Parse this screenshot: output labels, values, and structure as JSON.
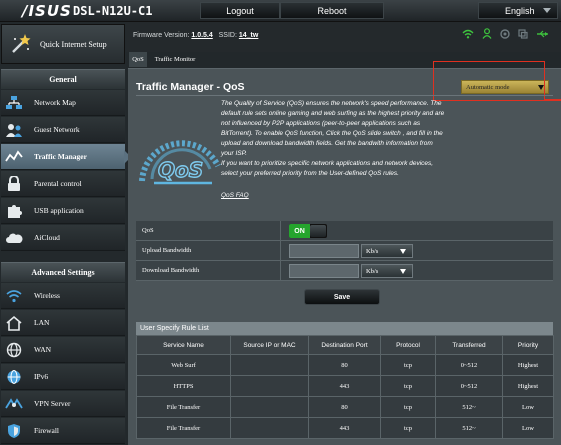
{
  "header": {
    "brand": "/ISUS",
    "model": "DSL-N12U-C1",
    "logout_label": "Logout",
    "reboot_label": "Reboot",
    "language": "English"
  },
  "infobar": {
    "firmware_label": "Firmware Version:",
    "firmware_version": "1.0.5.4",
    "ssid_label": "SSID:",
    "ssid_value": "14_tw"
  },
  "tabs": [
    {
      "label": "QoS"
    },
    {
      "label": "Traffic Monitor"
    }
  ],
  "sidebar": {
    "quick_setup": "Quick Internet Setup",
    "general_header": "General",
    "general_items": [
      {
        "label": "Network Map",
        "icon": "network-map-icon"
      },
      {
        "label": "Guest Network",
        "icon": "guest-network-icon"
      },
      {
        "label": "Traffic Manager",
        "icon": "traffic-manager-icon",
        "active": true
      },
      {
        "label": "Parental control",
        "icon": "lock-icon"
      },
      {
        "label": "USB application",
        "icon": "puzzle-icon"
      },
      {
        "label": "AiCloud",
        "icon": "cloud-icon"
      }
    ],
    "advanced_header": "Advanced Settings",
    "advanced_items": [
      {
        "label": "Wireless",
        "icon": "wifi-icon"
      },
      {
        "label": "LAN",
        "icon": "home-icon"
      },
      {
        "label": "WAN",
        "icon": "globe-icon"
      },
      {
        "label": "IPv6",
        "icon": "ipv6-icon"
      },
      {
        "label": "VPN Server",
        "icon": "vpn-icon"
      },
      {
        "label": "Firewall",
        "icon": "shield-icon"
      }
    ]
  },
  "panel": {
    "title": "Traffic Manager - QoS",
    "mode": "Automatic mode",
    "description_lines": [
      "The Quality of Service (QoS) ensures the network's speed performance. The",
      "default rule sets online gaming and web surfing as the highest priority and are",
      "not influenced by P2P applications (peer-to-peer applications such as",
      "BitTorrent). To enable QoS function, Click the QoS slide switch , and fill in the",
      "upload and download bandwidth fields. Get the bandwith information from",
      "your ISP.",
      "If you want to prioritize specific network applications and network devices,",
      "select your preferred priority from the User-defined QoS rules."
    ],
    "faq_link": "QoS FAQ",
    "logo_text": "QoS"
  },
  "settings": {
    "qos_label": "QoS",
    "qos_toggle": "ON",
    "upload_label": "Upload Bandwidth",
    "download_label": "Download Bandwidth",
    "upload_value": "",
    "download_value": "",
    "unit": "Kb/s",
    "save_label": "Save"
  },
  "rules": {
    "title": "User Specify Rule List",
    "columns": [
      "Service Name",
      "Source IP or MAC",
      "Destination Port",
      "Protocol",
      "Transferred",
      "Priority"
    ],
    "rows": [
      [
        "Web Surf",
        "",
        "80",
        "tcp",
        "0~512",
        "Highest"
      ],
      [
        "HTTPS",
        "",
        "443",
        "tcp",
        "0~512",
        "Highest"
      ],
      [
        "File Transfer",
        "",
        "80",
        "tcp",
        "512~",
        "Low"
      ],
      [
        "File Transfer",
        "",
        "443",
        "tcp",
        "512~",
        "Low"
      ]
    ]
  },
  "colors": {
    "accent_red_annotation": "#e03020",
    "toggle_on": "#25a52d",
    "mode_select": "#b89f42",
    "status_green": "#3ec43e"
  }
}
